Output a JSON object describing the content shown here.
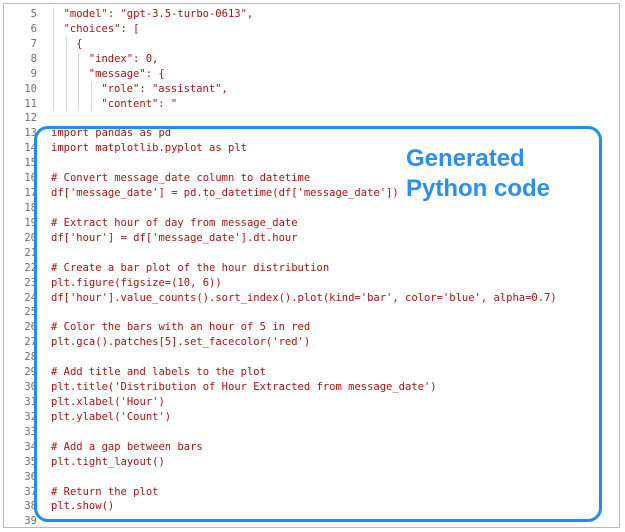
{
  "editor": {
    "lines": [
      {
        "n": "5",
        "text": "\"model\": \"gpt-3.5-turbo-0613\",",
        "indent": 1
      },
      {
        "n": "6",
        "text": "\"choices\": [",
        "indent": 1
      },
      {
        "n": "7",
        "text": "{",
        "indent": 2
      },
      {
        "n": "8",
        "text": "\"index\": 0,",
        "indent": 3
      },
      {
        "n": "9",
        "text": "\"message\": {",
        "indent": 3
      },
      {
        "n": "10",
        "text": "\"role\": \"assistant\",",
        "indent": 4
      },
      {
        "n": "11",
        "text": "\"content\": \"",
        "indent": 4
      },
      {
        "n": "12",
        "text": "",
        "indent": 0
      },
      {
        "n": "13",
        "text": "import pandas as pd",
        "indent": 0
      },
      {
        "n": "14",
        "text": "import matplotlib.pyplot as plt",
        "indent": 0
      },
      {
        "n": "15",
        "text": "",
        "indent": 0
      },
      {
        "n": "16",
        "text": "# Convert message_date column to datetime",
        "indent": 0
      },
      {
        "n": "17",
        "text": "df['message_date'] = pd.to_datetime(df['message_date'])",
        "indent": 0
      },
      {
        "n": "18",
        "text": "",
        "indent": 0
      },
      {
        "n": "19",
        "text": "# Extract hour of day from message_date",
        "indent": 0
      },
      {
        "n": "20",
        "text": "df['hour'] = df['message_date'].dt.hour",
        "indent": 0
      },
      {
        "n": "21",
        "text": "",
        "indent": 0
      },
      {
        "n": "22",
        "text": "# Create a bar plot of the hour distribution",
        "indent": 0
      },
      {
        "n": "23",
        "text": "plt.figure(figsize=(10, 6))",
        "indent": 0
      },
      {
        "n": "24",
        "text": "df['hour'].value_counts().sort_index().plot(kind='bar', color='blue', alpha=0.7)",
        "indent": 0
      },
      {
        "n": "25",
        "text": "",
        "indent": 0
      },
      {
        "n": "26",
        "text": "# Color the bars with an hour of 5 in red",
        "indent": 0
      },
      {
        "n": "27",
        "text": "plt.gca().patches[5].set_facecolor('red')",
        "indent": 0
      },
      {
        "n": "28",
        "text": "",
        "indent": 0
      },
      {
        "n": "29",
        "text": "# Add title and labels to the plot",
        "indent": 0
      },
      {
        "n": "30",
        "text": "plt.title('Distribution of Hour Extracted from message_date')",
        "indent": 0
      },
      {
        "n": "31",
        "text": "plt.xlabel('Hour')",
        "indent": 0
      },
      {
        "n": "32",
        "text": "plt.ylabel('Count')",
        "indent": 0
      },
      {
        "n": "33",
        "text": "",
        "indent": 0
      },
      {
        "n": "34",
        "text": "# Add a gap between bars",
        "indent": 0
      },
      {
        "n": "35",
        "text": "plt.tight_layout()",
        "indent": 0
      },
      {
        "n": "36",
        "text": "",
        "indent": 0
      },
      {
        "n": "37",
        "text": "# Return the plot",
        "indent": 0
      },
      {
        "n": "38",
        "text": "plt.show()",
        "indent": 0
      },
      {
        "n": "39",
        "text": "",
        "indent": 0
      }
    ]
  },
  "callout": {
    "line1": "Generated",
    "line2": "Python code",
    "color": "#2b8ff0"
  },
  "colors": {
    "code_text": "#a31515",
    "line_number": "#6e6e6e",
    "highlight_border": "#1f8ef1"
  }
}
